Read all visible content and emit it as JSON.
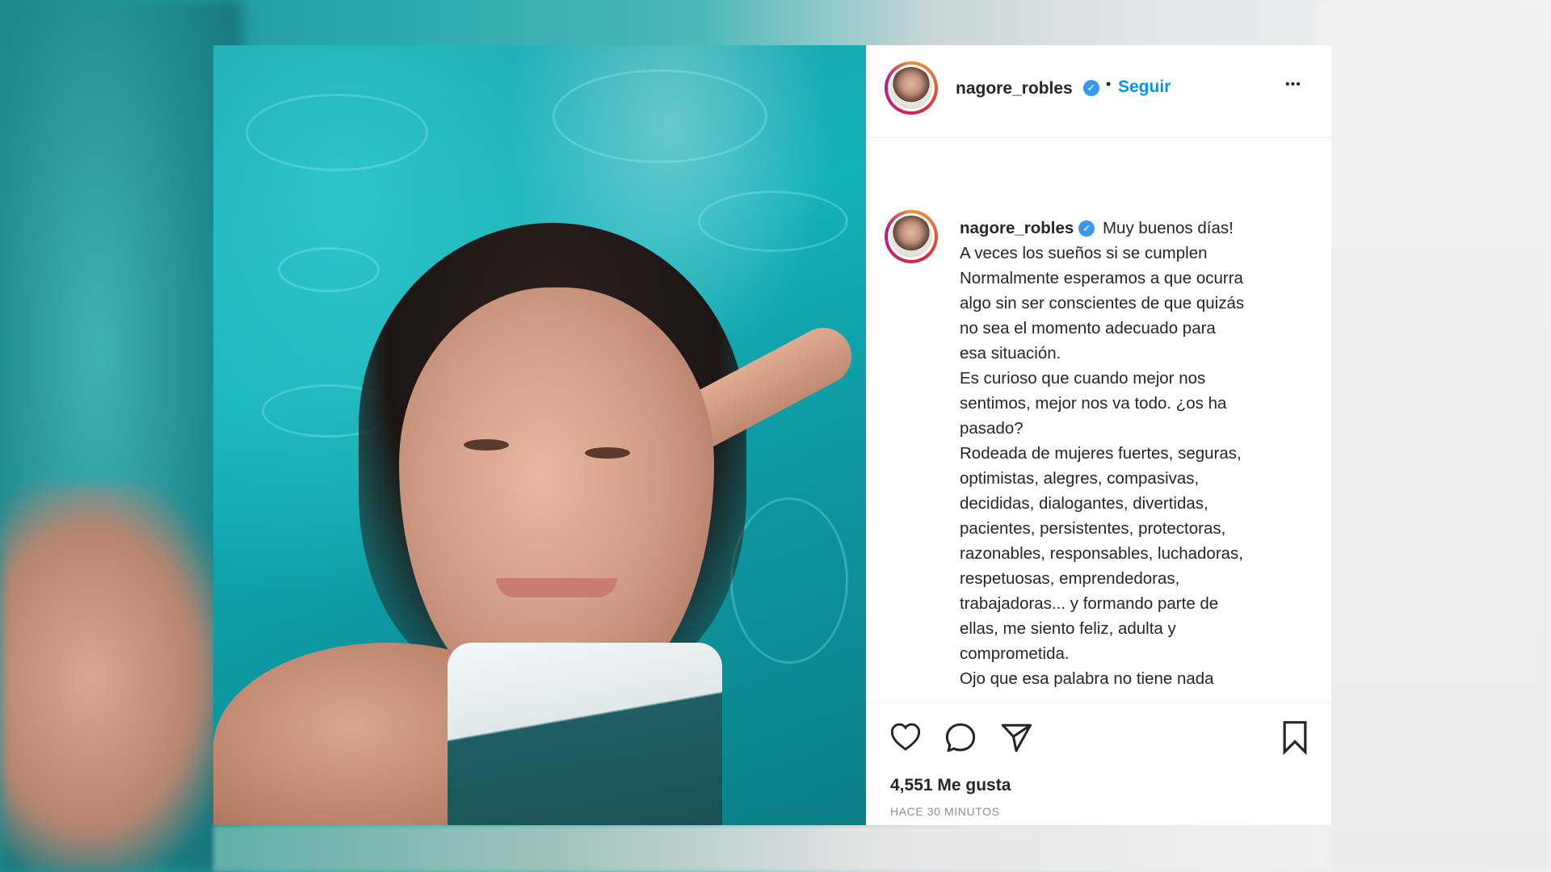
{
  "post": {
    "author": {
      "username": "nagore_robles",
      "verified_mark": "✓",
      "follow_label": "Seguir",
      "separator": "•",
      "more_label": "•••"
    },
    "caption": {
      "username": "nagore_robles",
      "text": " Muy buenos días!\nA veces los sueños si se cumplen\nNormalmente esperamos a que ocurra\nalgo sin ser conscientes de que quizás\nno sea el momento adecuado para\nesa situación.\nEs curioso que cuando mejor nos\nsentimos, mejor nos va todo. ¿os ha\npasado?\nRodeada de mujeres fuertes, seguras,\noptimistas, alegres, compasivas,\ndecididas, dialogantes, divertidas,\npacientes, persistentes, protectoras,\nrazonables, responsables, luchadoras,\nrespetuosas, emprendedoras,\ntrabajadoras... y formando parte de\nellas, me siento feliz, adulta y\ncomprometida.\nOjo que esa palabra no tiene nada"
    },
    "actions": {
      "like_icon": "heart-icon",
      "comment_icon": "comment-icon",
      "share_icon": "paper-plane-icon",
      "save_icon": "bookmark-icon"
    },
    "likes_text": "4,551 Me gusta",
    "timestamp": "HACE 30 MINUTOS",
    "colors": {
      "follow": "#0095f6",
      "verified": "#3897f0",
      "text": "#262626",
      "muted": "#8e8e8e"
    }
  }
}
